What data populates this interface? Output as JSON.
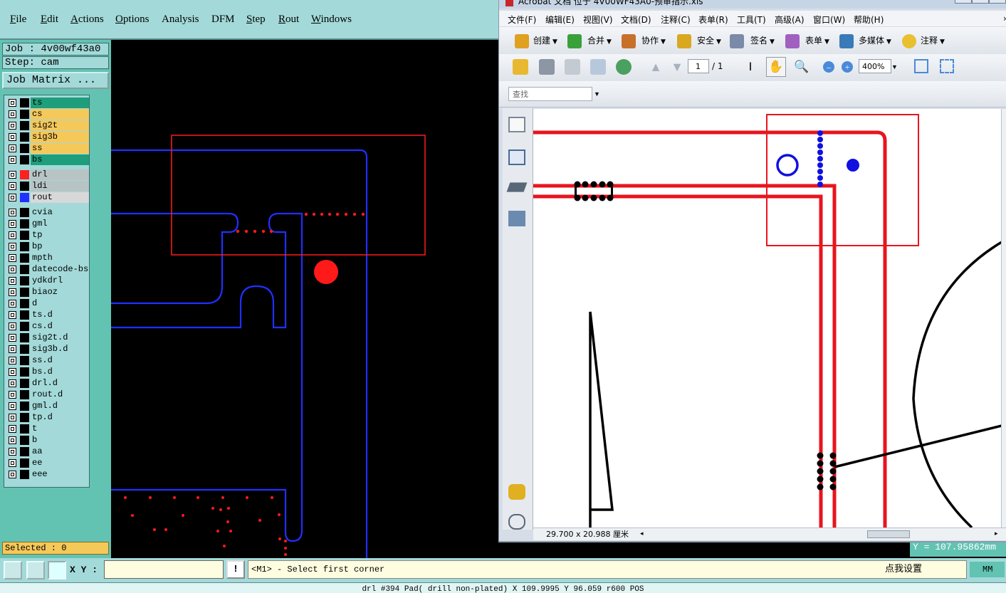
{
  "cam": {
    "menu": [
      "File",
      "Edit",
      "Actions",
      "Options",
      "Analysis",
      "DFM",
      "Step",
      "Rout",
      "Windows"
    ],
    "job_line": "Job : 4v00wf43a0",
    "step_line": "Step: cam",
    "job_matrix_label": "Job Matrix ...",
    "layers": [
      {
        "name": "ts",
        "bg": "#1e9e7a"
      },
      {
        "name": "cs",
        "bg": "#f5c85a"
      },
      {
        "name": "sig2t",
        "bg": "#f5c85a"
      },
      {
        "name": "sig3b",
        "bg": "#f5c85a"
      },
      {
        "name": "ss",
        "bg": "#f5c85a"
      },
      {
        "name": "bs",
        "bg": "#1e9e7a"
      },
      {
        "name": "drl",
        "bg": "#b8c4c4",
        "swatch": "#ff2020"
      },
      {
        "name": "ldi",
        "bg": "#b8c4c4"
      },
      {
        "name": "rout",
        "bg": "#d8d8d8",
        "swatch": "#2030ff"
      },
      {
        "name": "cvia",
        "bg": "#a3d9d9"
      },
      {
        "name": "gml",
        "bg": "#a3d9d9"
      },
      {
        "name": "tp",
        "bg": "#a3d9d9"
      },
      {
        "name": "bp",
        "bg": "#a3d9d9"
      },
      {
        "name": "mpth",
        "bg": "#a3d9d9"
      },
      {
        "name": "datecode-bs",
        "bg": "#a3d9d9"
      },
      {
        "name": "ydkdrl",
        "bg": "#a3d9d9"
      },
      {
        "name": "biaoz",
        "bg": "#a3d9d9"
      },
      {
        "name": "d",
        "bg": "#a3d9d9"
      },
      {
        "name": "ts.d",
        "bg": "#a3d9d9"
      },
      {
        "name": "cs.d",
        "bg": "#a3d9d9"
      },
      {
        "name": "sig2t.d",
        "bg": "#a3d9d9"
      },
      {
        "name": "sig3b.d",
        "bg": "#a3d9d9"
      },
      {
        "name": "ss.d",
        "bg": "#a3d9d9"
      },
      {
        "name": "bs.d",
        "bg": "#a3d9d9"
      },
      {
        "name": "drl.d",
        "bg": "#a3d9d9"
      },
      {
        "name": "rout.d",
        "bg": "#a3d9d9"
      },
      {
        "name": "gml.d",
        "bg": "#a3d9d9"
      },
      {
        "name": "tp.d",
        "bg": "#a3d9d9"
      },
      {
        "name": "t",
        "bg": "#a3d9d9"
      },
      {
        "name": "b",
        "bg": "#a3d9d9"
      },
      {
        "name": "aa",
        "bg": "#a3d9d9"
      },
      {
        "name": "ee",
        "bg": "#a3d9d9"
      },
      {
        "name": "eee",
        "bg": "#a3d9d9"
      }
    ],
    "selected_text": "Selected : 0",
    "xy_label": "X Y :",
    "xy_value": "",
    "excl_label": "!",
    "prompt_text": "<M1> - Select first corner",
    "setup_button": "点我设置",
    "units": "MM",
    "y_readout": "Y = 107.95862mm",
    "status_line": "drl #394 Pad( drill non-plated) X 109.9995 Y 96.059 r600 POS",
    "colors": {
      "teal": "#62c3b3",
      "light_teal": "#a3d9d9",
      "rout_blue": "#2030ff",
      "drill_red": "#ff1a1a"
    }
  },
  "acrobat": {
    "title": "Acrobat 文档 位于 4V00WF43A0-预审指示.xls",
    "menu": [
      "文件(F)",
      "编辑(E)",
      "视图(V)",
      "文档(D)",
      "注释(C)",
      "表单(R)",
      "工具(T)",
      "高级(A)",
      "窗口(W)",
      "帮助(H)"
    ],
    "toolbar": [
      {
        "label": "创建",
        "icon": "create-icon"
      },
      {
        "label": "合并",
        "icon": "combine-icon"
      },
      {
        "label": "协作",
        "icon": "collaborate-icon"
      },
      {
        "label": "安全",
        "icon": "lock-icon"
      },
      {
        "label": "签名",
        "icon": "pen-icon"
      },
      {
        "label": "表单",
        "icon": "form-icon"
      },
      {
        "label": "多媒体",
        "icon": "multimedia-icon"
      },
      {
        "label": "注释",
        "icon": "comment-icon"
      }
    ],
    "page_current": "1",
    "page_total": "/ 1",
    "zoom": "400%",
    "find_placeholder": "查找",
    "page_size": "29.700 x 20.988 厘米",
    "colors": {
      "trace_red": "#e8141e",
      "drill_blue": "#1010e0"
    }
  }
}
